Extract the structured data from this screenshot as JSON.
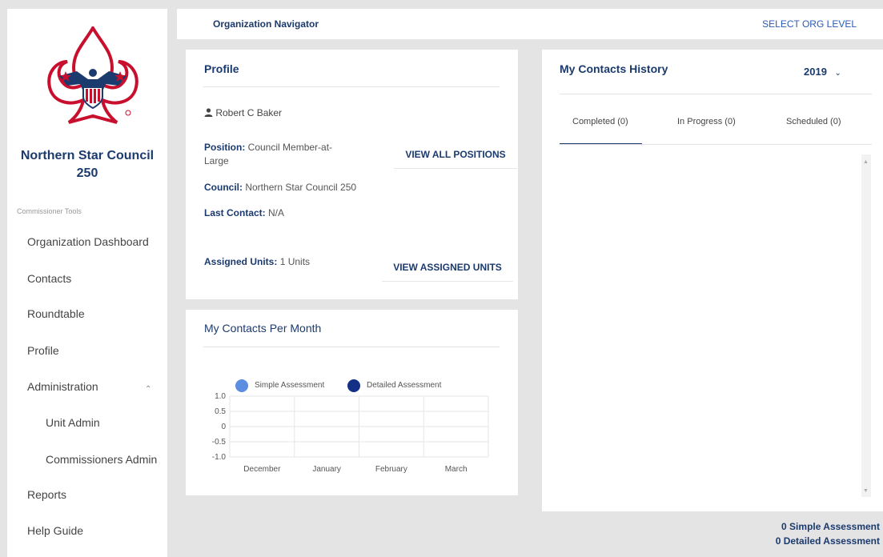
{
  "sidebar": {
    "council_name_line1": "Northern Star Council",
    "council_name_line2": "250",
    "section_caption": "Commissioner Tools",
    "items": [
      {
        "label": "Organization Dashboard"
      },
      {
        "label": "Contacts"
      },
      {
        "label": "Roundtable"
      },
      {
        "label": "Profile"
      },
      {
        "label": "Administration"
      },
      {
        "label": "Unit Admin"
      },
      {
        "label": "Commissioners Admin"
      },
      {
        "label": "Reports"
      },
      {
        "label": "Help Guide"
      }
    ]
  },
  "topbar": {
    "title": "Organization Navigator",
    "select_org_level": "SELECT ORG LEVEL"
  },
  "profile": {
    "title": "Profile",
    "name": "Robert C Baker",
    "position_label": "Position:",
    "position_value_line1": "Council Member-at-",
    "position_value_line2": "Large",
    "council_label": "Council:",
    "council_value": "Northern Star Council 250",
    "last_contact_label": "Last Contact:",
    "last_contact_value": "N/A",
    "assigned_units_label": "Assigned Units:",
    "assigned_units_value": "1 Units",
    "view_all_positions": "VIEW ALL POSITIONS",
    "view_assigned_units": "VIEW ASSIGNED UNITS"
  },
  "contacts_per_month": {
    "title": "My Contacts Per Month"
  },
  "history": {
    "title": "My Contacts History",
    "year": "2019",
    "tabs": [
      {
        "label": "Completed (0)"
      },
      {
        "label": "In Progress (0)"
      },
      {
        "label": "Scheduled (0)"
      }
    ],
    "footer_line1": "0 Simple Assessment",
    "footer_line2": "0 Detailed Assessment"
  },
  "colors": {
    "brand_navy": "#1b3a6e",
    "simple_assessment": "#5b8de0",
    "detailed_assessment": "#142f86"
  },
  "chart_data": {
    "type": "bar",
    "categories": [
      "December",
      "January",
      "February",
      "March"
    ],
    "series": [
      {
        "name": "Simple Assessment",
        "values": [
          0,
          0,
          0,
          0
        ],
        "color": "#5b8de0"
      },
      {
        "name": "Detailed Assessment",
        "values": [
          0,
          0,
          0,
          0
        ],
        "color": "#142f86"
      }
    ],
    "yticks": [
      "1.0",
      "0.5",
      "0",
      "-0.5",
      "-1.0"
    ],
    "ylim": [
      -1,
      1
    ],
    "legend": "top",
    "grid": true,
    "title": "",
    "xlabel": "",
    "ylabel": ""
  }
}
